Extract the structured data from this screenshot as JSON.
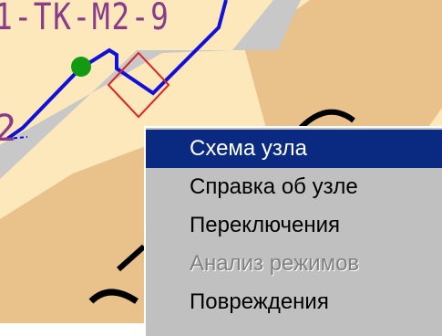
{
  "map": {
    "node_label": "1-ТК-М2-9",
    "pipe_label": "2",
    "colors": {
      "background_light": "#fde8bc",
      "block_tan": "#e8c28a",
      "pipe_corridor": "#c8c8c8",
      "pipe_line": "#1010d8",
      "node_marker": "#129b12",
      "selection": "#e02020"
    }
  },
  "context_menu": {
    "items": [
      {
        "label": "Схема узла",
        "state": "selected"
      },
      {
        "label": "Справка об узле",
        "state": "normal"
      },
      {
        "label": "Переключения",
        "state": "normal"
      },
      {
        "label": "Анализ режимов",
        "state": "disabled"
      },
      {
        "label": "Повреждения",
        "state": "normal"
      }
    ],
    "colors": {
      "menu_bg": "#c0c0c0",
      "highlight": "#0a2a82",
      "disabled_text": "#808080"
    }
  }
}
